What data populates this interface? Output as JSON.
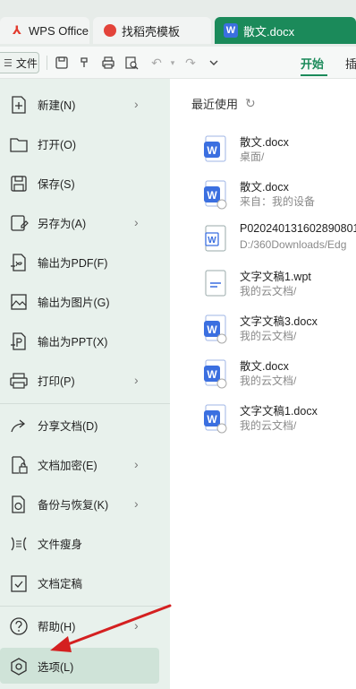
{
  "tabs": [
    {
      "label": "WPS Office",
      "icon": "wps-logo-icon"
    },
    {
      "label": "找稻壳模板",
      "icon": "daoke-logo-icon"
    },
    {
      "label": "散文.docx",
      "icon": "word-doc-icon",
      "active": true
    }
  ],
  "toolbar": {
    "file_label": "文件",
    "start_tab": "开始",
    "next_tab": "插"
  },
  "menu": [
    {
      "label": "新建(N)",
      "icon": "new-file-icon",
      "submenu": true
    },
    {
      "label": "打开(O)",
      "icon": "folder-open-icon",
      "submenu": false
    },
    {
      "label": "保存(S)",
      "icon": "save-icon",
      "submenu": false
    },
    {
      "label": "另存为(A)",
      "icon": "save-as-icon",
      "submenu": true
    },
    {
      "label": "输出为PDF(F)",
      "icon": "export-pdf-icon",
      "submenu": false
    },
    {
      "label": "输出为图片(G)",
      "icon": "export-image-icon",
      "submenu": false
    },
    {
      "label": "输出为PPT(X)",
      "icon": "export-ppt-icon",
      "submenu": false
    },
    {
      "label": "打印(P)",
      "icon": "print-icon",
      "submenu": true
    },
    {
      "label": "分享文档(D)",
      "icon": "share-icon",
      "submenu": false
    },
    {
      "label": "文档加密(E)",
      "icon": "encrypt-icon",
      "submenu": true
    },
    {
      "label": "备份与恢复(K)",
      "icon": "backup-icon",
      "submenu": true
    },
    {
      "label": "文件瘦身",
      "icon": "slim-icon",
      "submenu": false
    },
    {
      "label": "文档定稿",
      "icon": "finalize-icon",
      "submenu": false
    },
    {
      "label": "帮助(H)",
      "icon": "help-icon",
      "submenu": true
    },
    {
      "label": "选项(L)",
      "icon": "options-icon",
      "submenu": false
    }
  ],
  "recent": {
    "title": "最近使用",
    "files": [
      {
        "name": "散文.docx",
        "path": "桌面/",
        "type": "docx"
      },
      {
        "name": "散文.docx",
        "path": "来自：我的设备",
        "type": "docx"
      },
      {
        "name": "P020240131602890801",
        "path": "D:/360Downloads/Edg",
        "type": "doc"
      },
      {
        "name": "文字文稿1.wpt",
        "path": "我的云文档/",
        "type": "wpt"
      },
      {
        "name": "文字文稿3.docx",
        "path": "我的云文档/",
        "type": "docx"
      },
      {
        "name": "散文.docx",
        "path": "我的云文档/",
        "type": "docx"
      },
      {
        "name": "文字文稿1.docx",
        "path": "我的云文档/",
        "type": "docx"
      }
    ]
  },
  "colors": {
    "accent": "#1b8a5a",
    "menu_bg": "#e8f1ec",
    "arrow": "#d42020",
    "word_blue": "#3b6fe0"
  }
}
